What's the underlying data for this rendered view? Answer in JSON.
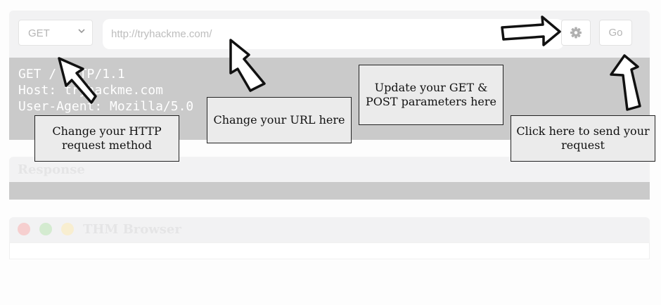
{
  "request": {
    "method": "GET",
    "url_placeholder": "http://tryhackme.com/",
    "go_label": "Go",
    "lines": [
      "GET / HTTP/1.1",
      "Host: tryhackme.com",
      "User-Agent: Mozilla/5.0"
    ]
  },
  "response": {
    "title": "Response"
  },
  "browser": {
    "title": "THM Browser"
  },
  "annotations": {
    "method": "Change your HTTP request method",
    "url": "Change your URL here",
    "params": "Update your GET & POST parameters here",
    "send": "Click here to send your request"
  },
  "icons": {
    "method_chevron": "chevron-down-icon",
    "settings": "gear-icon",
    "arrows": "hand-drawn-arrow-icon"
  },
  "colors": {
    "panel": "#f2f2f3",
    "request_body": "#cacaca",
    "callout_bg": "#ebebeb",
    "dot_red": "#f6cfcf",
    "dot_green": "#d4ebd0",
    "dot_yellow": "#f8eed0"
  }
}
